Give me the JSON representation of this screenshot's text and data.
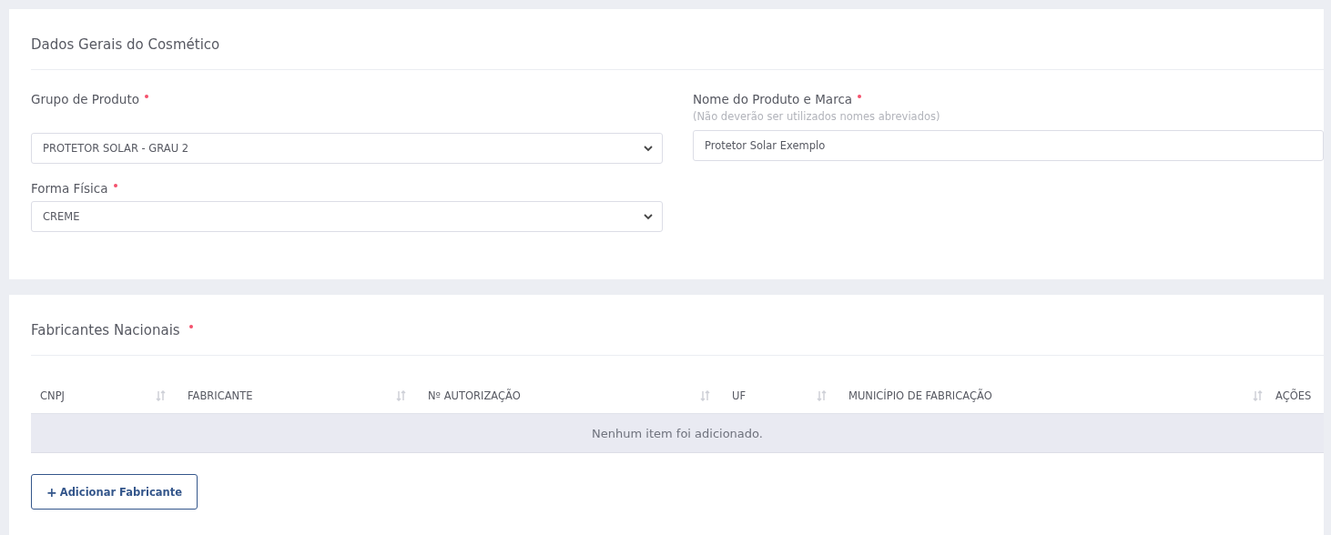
{
  "general_card": {
    "title": "Dados Gerais do Cosmético",
    "fields": [
      {
        "kind": "select",
        "label": "Grupo de Produto",
        "required": true,
        "value": "PROTETOR SOLAR - GRAU 2"
      },
      {
        "kind": "text",
        "label": "Nome do Produto e Marca",
        "required": true,
        "hint": "(Não deverão ser utilizados nomes abreviados)",
        "value": "Protetor Solar Exemplo"
      },
      {
        "kind": "select",
        "label": "Forma Física",
        "required": true,
        "value": "CREME"
      }
    ]
  },
  "manufacturers_card": {
    "title": "Fabricantes Nacionais",
    "required": true,
    "table": {
      "columns": [
        {
          "label": "CNPJ",
          "sortable": true
        },
        {
          "label": "FABRICANTE",
          "sortable": true
        },
        {
          "label": "Nº AUTORIZAÇÃO",
          "sortable": true
        },
        {
          "label": "UF",
          "sortable": true
        },
        {
          "label": "MUNICÍPIO DE FABRICAÇÃO",
          "sortable": true
        },
        {
          "label": "AÇÕES",
          "sortable": false
        }
      ],
      "empty_message": "Nenhum item foi adicionado."
    },
    "add_button": {
      "icon": "+",
      "label": "Adicionar Fabricante"
    }
  }
}
